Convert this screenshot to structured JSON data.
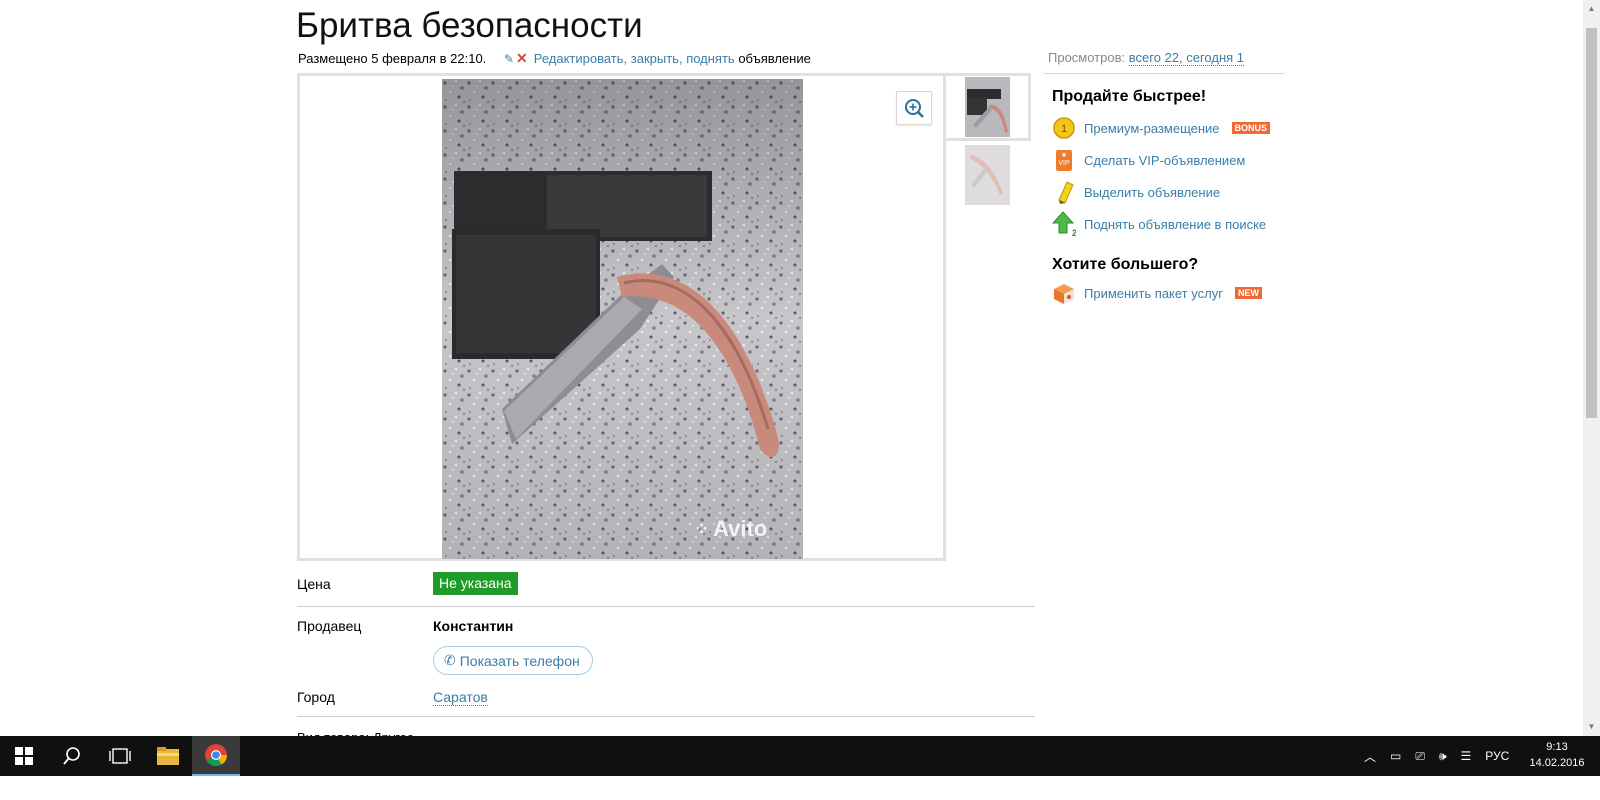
{
  "listing": {
    "title": "Бритва безопасности",
    "posted": "Размещено 5 февраля в 22:10.",
    "edit_link": "Редактировать,",
    "close_link": "закрыть,",
    "raise_link": "поднять",
    "suffix": "объявление"
  },
  "views": {
    "label": "Просмотров:",
    "value": "всего 22, сегодня 1"
  },
  "gallery": {
    "watermark": "Avito",
    "thumb_count": 2
  },
  "details": {
    "price_label": "Цена",
    "price_value": "Не указана",
    "seller_label": "Продавец",
    "seller_name": "Константин",
    "phone_button": "Показать телефон",
    "city_label": "Город",
    "city_value": "Саратов",
    "cut_off_text": "Вид товара: Другое"
  },
  "promo": {
    "heading": "Продайте быстрее!",
    "items": [
      {
        "label": "Премиум-размещение",
        "badge": "BONUS",
        "icon": "premium-coin-icon"
      },
      {
        "label": "Сделать VIP-объявлением",
        "badge": "",
        "icon": "vip-icon"
      },
      {
        "label": "Выделить объявление",
        "badge": "",
        "icon": "highlighter-icon"
      },
      {
        "label": "Поднять объявление в поиске",
        "badge": "",
        "icon": "raise-arrow-icon"
      }
    ],
    "heading2": "Хотите большего?",
    "package": {
      "label": "Применить пакет услуг",
      "badge": "NEW",
      "icon": "package-icon"
    }
  },
  "taskbar": {
    "language": "РУС",
    "time": "9:13",
    "date": "14.02.2016"
  },
  "colors": {
    "link": "#3a7ea8",
    "price_badge": "#1f9b29",
    "badge_orange": "#f06a35",
    "taskbar": "#101010"
  }
}
